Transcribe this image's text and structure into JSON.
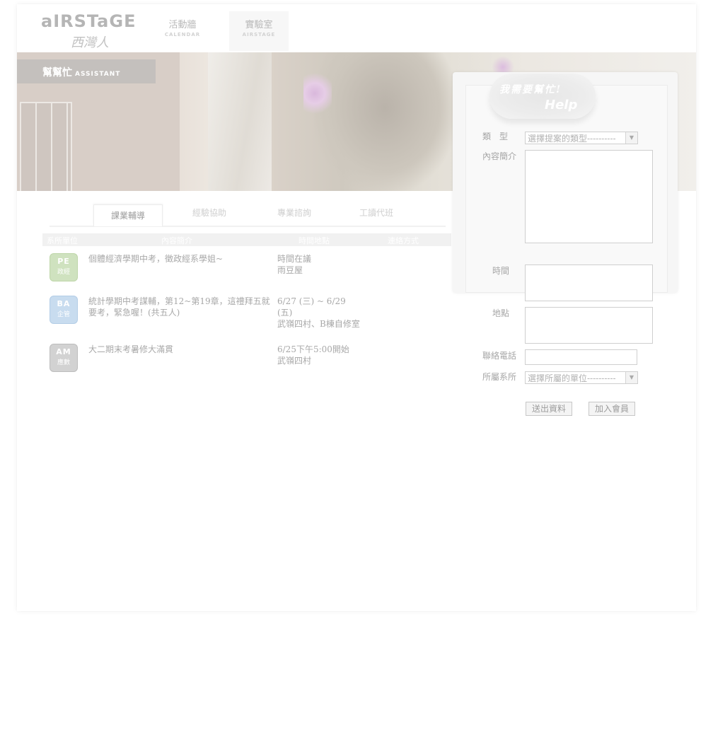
{
  "header": {
    "logo_brand": "aIRSTaGE",
    "logo_sub": "西灣人",
    "nav": [
      {
        "label": "活動牆",
        "en": "CALENDAR"
      },
      {
        "label": "實驗室",
        "en": "AIRSTAGE"
      }
    ]
  },
  "banner": {
    "title": "幫幫忙",
    "title_en": "ASSISTANT"
  },
  "tabs": [
    "課業輔導",
    "經驗協助",
    "專業諮詢",
    "工讀代班"
  ],
  "table": {
    "headers": [
      "系所單位",
      "內容簡介",
      "時間地點",
      "連絡方式"
    ],
    "rows": [
      {
        "badge_code": "PE",
        "badge_zh": "政經",
        "desc": "個體經濟學期中考，徵政經系學姐~",
        "time": "時間在議\n雨豆屋"
      },
      {
        "badge_code": "BA",
        "badge_zh": "企管",
        "desc": "統計學期中考謀輔，第12~第19章，這禮拜五就要考，緊急喔！(共五人)",
        "time": "6/27 (三) ~ 6/29 (五)\n武嶺四村、B棟自修室"
      },
      {
        "badge_code": "AM",
        "badge_zh": "應數",
        "desc": "大二期末考暑修大滿貫",
        "time": "6/25下午5:00開始\n武嶺四村"
      }
    ]
  },
  "help": {
    "cloud_zh": "我需要幫忙!",
    "cloud_en": "Help",
    "type_label": "類　型",
    "type_value": "選擇提案的類型----------",
    "content_label": "內容簡介",
    "time_label": "時間",
    "place_label": "地點",
    "phone_label": "聯絡電話",
    "dept_label": "所屬系所",
    "dept_value": "選擇所屬的單位----------",
    "submit_label": "送出資料",
    "join_label": "加入會員"
  }
}
